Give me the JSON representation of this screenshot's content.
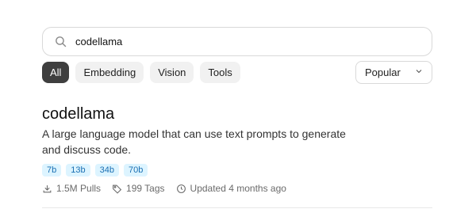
{
  "search": {
    "value": "codellama",
    "placeholder": ""
  },
  "filters": [
    {
      "label": "All",
      "active": true
    },
    {
      "label": "Embedding"
    },
    {
      "label": "Vision"
    },
    {
      "label": "Tools"
    }
  ],
  "sort": {
    "label": "Popular"
  },
  "model": {
    "name": "codellama",
    "description": "A large language model that can use text prompts to generate and discuss code.",
    "tags": [
      "7b",
      "13b",
      "34b",
      "70b"
    ],
    "pulls": "1.5M Pulls",
    "tags_count": "199 Tags",
    "updated": "Updated 4 months ago"
  }
}
